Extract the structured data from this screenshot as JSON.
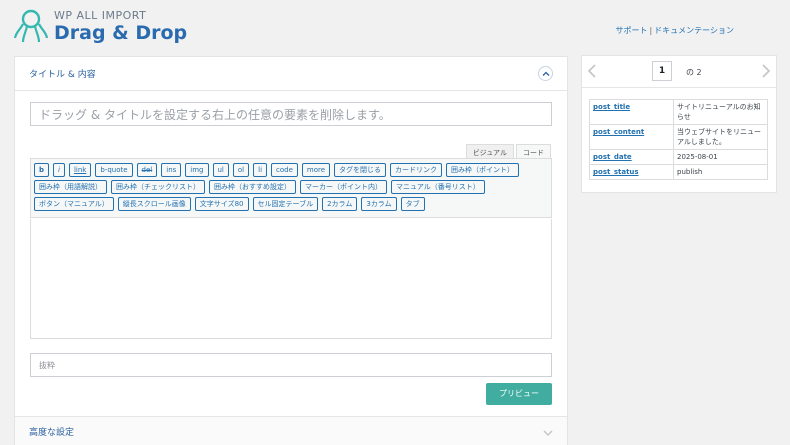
{
  "brand": {
    "top": "WP ALL IMPORT",
    "main": "Drag & Drop"
  },
  "header": {
    "support": "サポート",
    "separator": "|",
    "docs": "ドキュメンテーション"
  },
  "panel": {
    "title": "タイトル & 内容",
    "title_placeholder": "ドラッグ & タイトルを設定する右上の任意の要素を削除します。",
    "tabs": [
      "ビジュアル",
      "コード"
    ],
    "toolbar": [
      "b",
      "i",
      "link",
      "b-quote",
      "del",
      "ins",
      "img",
      "ul",
      "ol",
      "li",
      "code",
      "more",
      "タグを閉じる",
      "カードリンク",
      "囲み枠（ポイント）",
      "囲み枠（用語解説）",
      "囲み枠（チェックリスト）",
      "囲み枠（おすすめ設定）",
      "マーカー（ポイント内）",
      "マニュアル（番号リスト）",
      "ボタン（マニュアル）",
      "縦長スクロール画像",
      "文字サイズ80",
      "セル固定テーブル",
      "2カラム",
      "3カラム",
      "タブ"
    ],
    "excerpt_placeholder": "抜粋",
    "preview_label": "プリビュー",
    "advanced_title": "高度な設定"
  },
  "pager": {
    "current": "1",
    "of_label": "の 2"
  },
  "fields": [
    {
      "key": "post_title",
      "value": "サイトリニューアルのお知らせ"
    },
    {
      "key": "post_content",
      "value": "当ウェブサイトをリニューアルしました。"
    },
    {
      "key": "post_date",
      "value": "2025-08-01"
    },
    {
      "key": "post_status",
      "value": "publish"
    }
  ],
  "colors": {
    "accent": "#2271b1",
    "brand": "#2a6bb0",
    "button": "#40ada0"
  }
}
